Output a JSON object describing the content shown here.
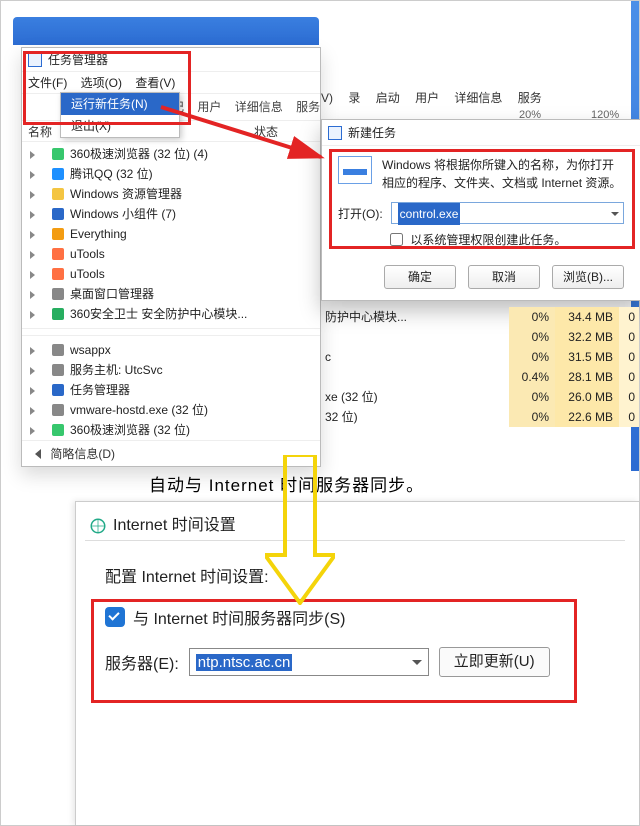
{
  "taskmgr": {
    "title": "任务管理器",
    "menus": {
      "file": "文件(F)",
      "options": "选项(O)",
      "view": "查看(V)"
    },
    "file_menu": {
      "new_task": "运行新任务(N)",
      "exit": "退出(X)"
    },
    "tabs_right": {
      "rec": "记",
      "user": "用户",
      "detail": "详细信息",
      "service": "服务"
    },
    "cols": {
      "name": "名称",
      "status": "状态"
    },
    "procs": [
      "360极速浏览器 (32 位) (4)",
      "腾讯QQ (32 位)",
      "Windows 资源管理器",
      "Windows 小组件 (7)",
      "Everything",
      "uTools",
      "uTools",
      "桌面窗口管理器",
      "360安全卫士 安全防护中心模块...",
      "wsappx",
      "服务主机: UtcSvc",
      "任务管理器",
      "vmware-hostd.exe (32 位)",
      "360极速浏览器 (32 位)"
    ],
    "footer": "简略信息(D)"
  },
  "right_tabs": {
    "v": "V)",
    "rec": "录",
    "start": "启动",
    "user": "用户",
    "detail": "详细信息",
    "service": "服务"
  },
  "right_pct1": "20%",
  "right_pct2": "120%",
  "newtask": {
    "title": "新建任务",
    "desc": "Windows 将根据你所键入的名称，为你打开相应的程序、文件夹、文档或 Internet 资源。",
    "open_label": "打开(O):",
    "open_value": "control.exe",
    "admin_chk": "以系统管理权限创建此任务。",
    "ok": "确定",
    "cancel": "取消",
    "browse": "浏览(B)..."
  },
  "rt_rows": [
    {
      "n": "防护中心模块...",
      "c": "0%",
      "m": "34.4 MB",
      "d": "0"
    },
    {
      "n": "",
      "c": "0%",
      "m": "32.2 MB",
      "d": "0"
    },
    {
      "n": "c",
      "c": "0%",
      "m": "31.5 MB",
      "d": "0"
    },
    {
      "n": "",
      "c": "0.4%",
      "m": "28.1 MB",
      "d": "0"
    },
    {
      "n": "xe (32 位)",
      "c": "0%",
      "m": "26.0 MB",
      "d": "0"
    },
    {
      "n": "32 位)",
      "c": "0%",
      "m": "22.6 MB",
      "d": "0"
    }
  ],
  "time": {
    "banner": "自动与 Internet 时间服务器同步。",
    "dlg_title": "Internet 时间设置",
    "cfg": "配置 Internet 时间设置:",
    "sync": "与 Internet 时间服务器同步(S)",
    "server_label": "服务器(E):",
    "server_value": "ntp.ntsc.ac.cn",
    "update": "立即更新(U)"
  }
}
